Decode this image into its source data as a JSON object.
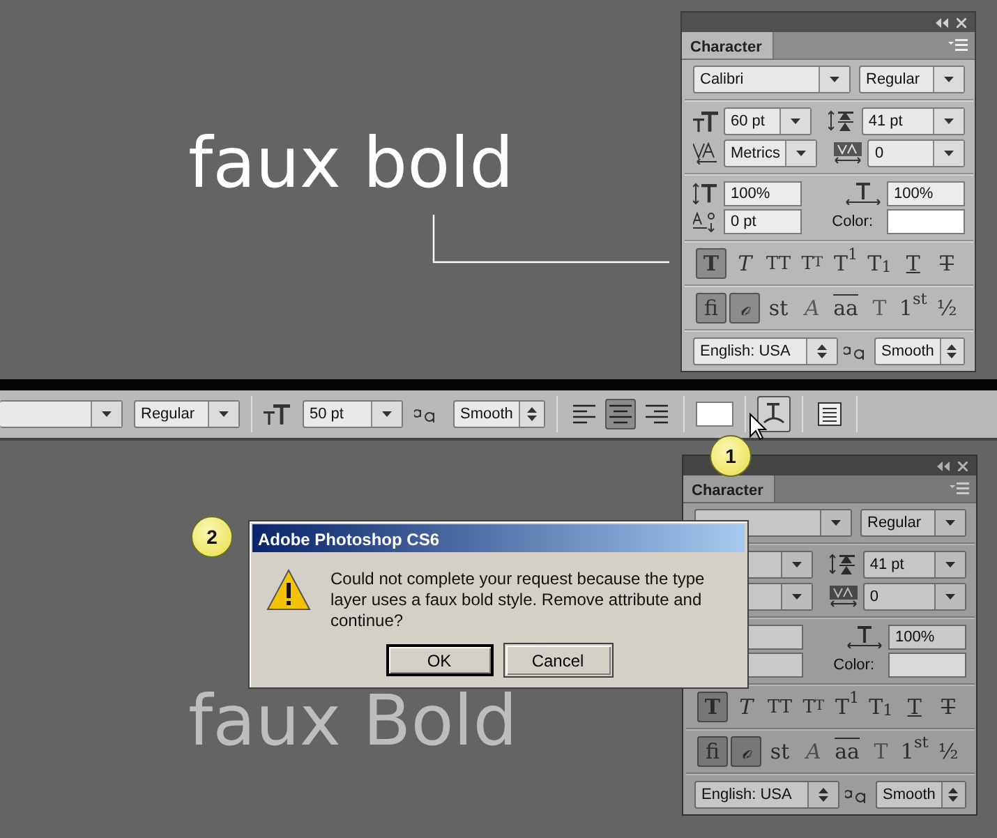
{
  "upper_canvas": {
    "text": "faux bold"
  },
  "character_panel": {
    "tab": "Character",
    "font_family": "Calibri",
    "font_style": "Regular",
    "font_size": "60 pt",
    "leading": "41 pt",
    "kerning": "Metrics",
    "tracking": "0",
    "vertical_scale": "100%",
    "horizontal_scale": "100%",
    "baseline_shift": "0 pt",
    "color_label": "Color:",
    "type_styles": [
      {
        "kind": "bold",
        "label": "T",
        "selected": true
      },
      {
        "kind": "italic",
        "label": "T",
        "selected": false
      },
      {
        "kind": "caps",
        "label": "TT",
        "selected": false
      },
      {
        "kind": "smallcaps",
        "label": "TT",
        "selected": false
      },
      {
        "kind": "plain",
        "label": "T$^{1}$",
        "selected": false
      },
      {
        "kind": "plain",
        "label": "T$_{1}$",
        "selected": false
      },
      {
        "kind": "underline",
        "label": "T",
        "selected": false
      },
      {
        "kind": "strike",
        "label": "T",
        "selected": false
      }
    ],
    "opentype": [
      {
        "kind": "plain",
        "label": "fi",
        "selected": true,
        "disabled": false
      },
      {
        "kind": "italic",
        "label": "ℴ",
        "selected": true,
        "disabled": false
      },
      {
        "kind": "plain",
        "label": "st",
        "selected": false,
        "disabled": false
      },
      {
        "kind": "italic",
        "label": "A",
        "selected": false,
        "disabled": true
      },
      {
        "kind": "overline",
        "label": "aa",
        "selected": false,
        "disabled": false
      },
      {
        "kind": "plain",
        "label": "T",
        "selected": false,
        "disabled": true
      },
      {
        "kind": "plain",
        "label": "1$^{st}$",
        "selected": false,
        "disabled": false
      },
      {
        "kind": "plain",
        "label": "½",
        "selected": false,
        "disabled": false
      }
    ],
    "language": "English: USA",
    "antialias": "Smooth"
  },
  "options_bar": {
    "font_style": "Regular",
    "font_size": "50 pt",
    "antialias": "Smooth",
    "alignment": [
      {
        "selected": false
      },
      {
        "selected": true
      },
      {
        "selected": false
      }
    ],
    "warp_pressed": true
  },
  "callouts": [
    "1",
    "2"
  ],
  "lower_canvas": {
    "text": "faux Bold"
  },
  "dimmed_panel": {
    "tab": "Character",
    "font_style": "Regular",
    "leading": "41 pt",
    "tracking": "0",
    "horizontal_scale": "100%",
    "color_label": "Color:",
    "type_styles": [
      {
        "kind": "bold",
        "label": "T",
        "selected": true
      },
      {
        "kind": "italic",
        "label": "T",
        "selected": false
      },
      {
        "kind": "caps",
        "label": "TT",
        "selected": false
      },
      {
        "kind": "smallcaps",
        "label": "TT",
        "selected": false
      },
      {
        "kind": "plain",
        "label": "T$^{1}$",
        "selected": false
      },
      {
        "kind": "plain",
        "label": "T$_{1}$",
        "selected": false
      },
      {
        "kind": "underline",
        "label": "T",
        "selected": false
      },
      {
        "kind": "strike",
        "label": "T",
        "selected": false
      }
    ],
    "opentype": [
      {
        "kind": "plain",
        "label": "fi",
        "selected": true,
        "disabled": false
      },
      {
        "kind": "italic",
        "label": "ℴ",
        "selected": true,
        "disabled": false
      },
      {
        "kind": "plain",
        "label": "st",
        "selected": false,
        "disabled": false
      },
      {
        "kind": "italic",
        "label": "A",
        "selected": false,
        "disabled": true
      },
      {
        "kind": "overline",
        "label": "aa",
        "selected": false,
        "disabled": false
      },
      {
        "kind": "plain",
        "label": "T",
        "selected": false,
        "disabled": true
      },
      {
        "kind": "plain",
        "label": "1$^{st}$",
        "selected": false,
        "disabled": false
      },
      {
        "kind": "plain",
        "label": "½",
        "selected": false,
        "disabled": false
      }
    ],
    "language": "English: USA",
    "antialias": "Smooth"
  },
  "dialog": {
    "title": "Adobe Photoshop CS6",
    "message": "Could not complete your request because the type layer uses a faux bold style.  Remove attribute and continue?",
    "buttons": [
      {
        "label": "OK",
        "focused": true
      },
      {
        "label": "Cancel",
        "focused": false
      }
    ]
  }
}
